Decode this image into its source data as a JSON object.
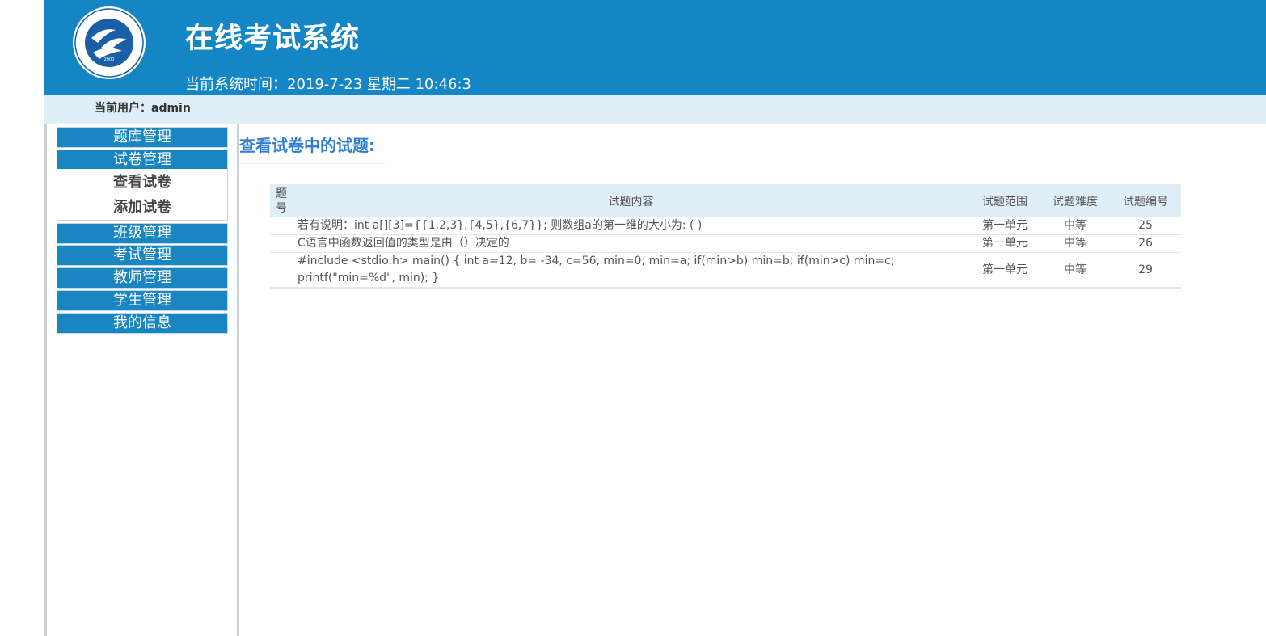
{
  "header": {
    "logo_text": "ANHUI XINHUA UNIVERSITY",
    "logo_year": "2000",
    "logo_script": "安徽新华学院",
    "title": "在线考试系统",
    "time_label": "当前系统时间：",
    "time_value": "2019-7-23 星期二 10:46:3"
  },
  "userbar": {
    "label": "当前用户：",
    "username": "admin"
  },
  "sidebar": {
    "menu": [
      {
        "label": "题库管理"
      },
      {
        "label": "试卷管理"
      },
      {
        "label": "班级管理"
      },
      {
        "label": "考试管理"
      },
      {
        "label": "教师管理"
      },
      {
        "label": "学生管理"
      },
      {
        "label": "我的信息"
      }
    ],
    "submenu": [
      {
        "label": "查看试卷"
      },
      {
        "label": "添加试卷"
      }
    ]
  },
  "main": {
    "heading": "查看试卷中的试题:",
    "table": {
      "headers": {
        "no": "题号",
        "content": "试题内容",
        "range": "试题范围",
        "difficulty": "试题难度",
        "id": "试题编号"
      },
      "rows": [
        {
          "no": "",
          "content": "若有说明：int a[][3]={{1,2,3},{4,5},{6,7}}; 则数组a的第一维的大小为: ( )",
          "range": "第一单元",
          "difficulty": "中等",
          "id": "25"
        },
        {
          "no": "",
          "content": "C语言中函数返回值的类型是由（）决定的",
          "range": "第一单元",
          "difficulty": "中等",
          "id": "26"
        },
        {
          "no": "",
          "content": "#include <stdio.h> main() { int a=12, b= -34, c=56, min=0; min=a; if(min>b) min=b; if(min>c) min=c; printf(\"min=%d\", min); }",
          "range": "第一单元",
          "difficulty": "中等",
          "id": "29"
        }
      ]
    }
  },
  "colors": {
    "header_bg": "#1485c5",
    "userbar_bg": "#e0eef8",
    "menu_bg": "#1985c1",
    "heading": "#2e7dd1"
  }
}
